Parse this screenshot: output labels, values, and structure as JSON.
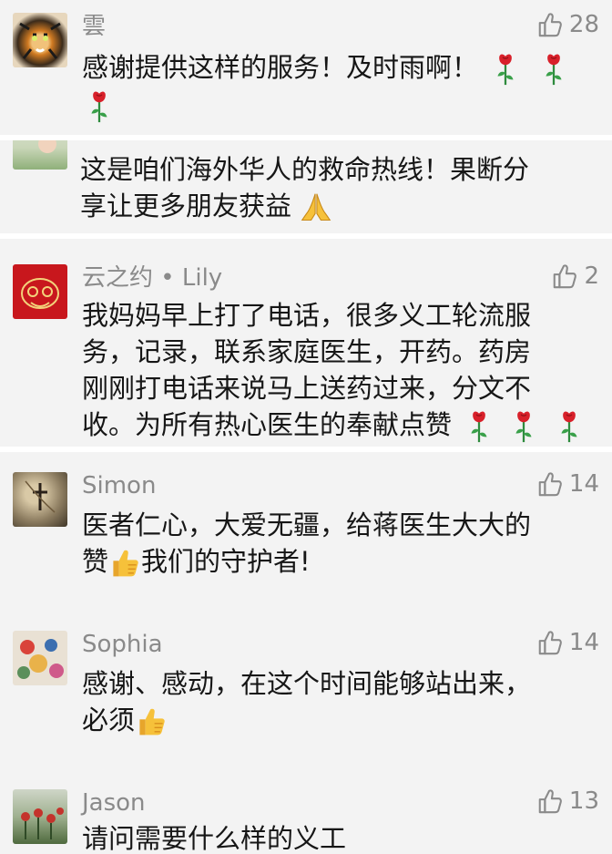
{
  "comments": [
    {
      "name": "雲",
      "likes": "28",
      "lines": [
        "感谢提供这样的服务！及时雨啊！",
        ""
      ]
    },
    {
      "name": "",
      "likes": "",
      "lines": [
        "这是咱们海外华人的救命热线！果断分",
        "享让更多朋友获益"
      ]
    },
    {
      "name": "云之约 • Lily",
      "likes": "2",
      "lines": [
        "我妈妈早上打了电话，很多义工轮流服",
        "务，记录，联系家庭医生，开药。药房",
        "刚刚打电话来说马上送药过来，分文不",
        "收。为所有热心医生的奉献点赞"
      ]
    },
    {
      "name": "Simon",
      "likes": "14",
      "lines": [
        "医者仁心，大爱无疆，给蒋医生大大的",
        "赞",
        "我们的守护者!"
      ]
    },
    {
      "name": "Sophia",
      "likes": "14",
      "lines": [
        "感谢、感动，在这个时间能够站出来，",
        "必须"
      ]
    },
    {
      "name": "Jason",
      "likes": "13",
      "lines": [
        "请问需要什么样的义工"
      ]
    }
  ],
  "icons": {
    "like": "thumbs-up-outline-icon",
    "rose": "rose-emoji",
    "folded_hands": "folded-hands-emoji",
    "thumbs_up": "thumbs-up-emoji"
  },
  "colors": {
    "background": "#f3f3f3",
    "divider": "#ffffff",
    "name": "#8a8a8a",
    "text": "#161616"
  }
}
